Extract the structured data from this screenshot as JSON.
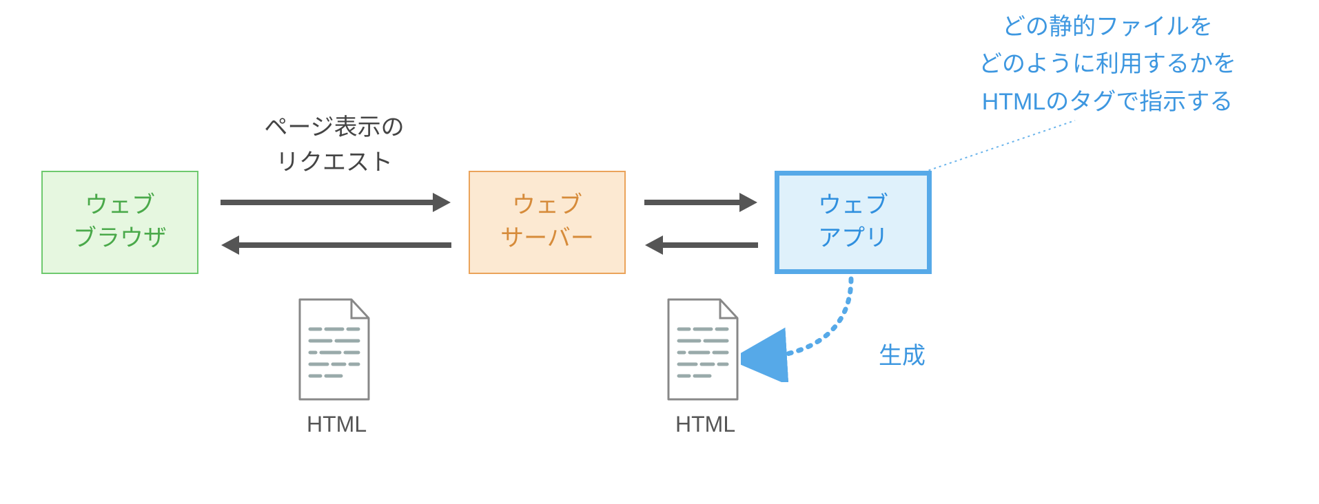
{
  "nodes": {
    "browser": {
      "line1": "ウェブ",
      "line2": "ブラウザ"
    },
    "server": {
      "line1": "ウェブ",
      "line2": "サーバー"
    },
    "app": {
      "line1": "ウェブ",
      "line2": "アプリ"
    }
  },
  "arrows": {
    "request_top": {
      "line1": "ページ表示の",
      "line2": "リクエスト"
    }
  },
  "docs": {
    "html_left": "HTML",
    "html_right": "HTML"
  },
  "annotation": {
    "line1": "どの静的ファイルを",
    "line2": "どのように利用するかを",
    "line3": "HTMLのタグで指示する"
  },
  "generate_label": "生成"
}
